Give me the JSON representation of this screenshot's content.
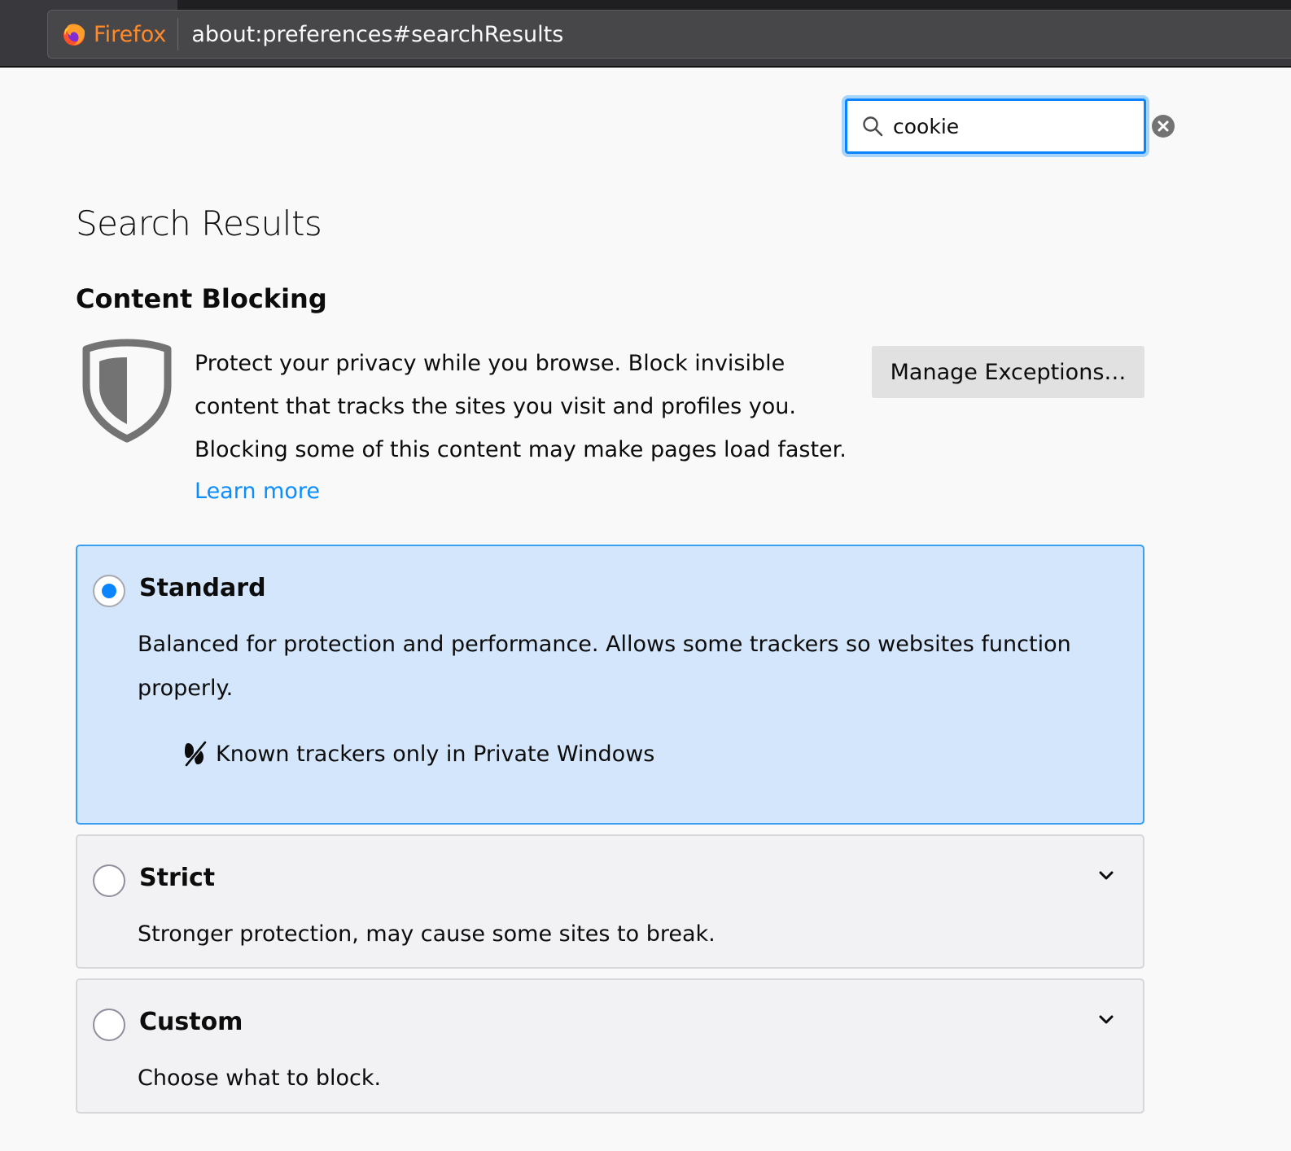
{
  "browser": {
    "name": "Firefox",
    "url": "about:preferences#searchResults"
  },
  "search": {
    "value": "cookie",
    "icon": "search-icon",
    "clear_icon": "clear-icon"
  },
  "page": {
    "title": "Search Results"
  },
  "content_blocking": {
    "heading": "Content Blocking",
    "description": "Protect your privacy while you browse. Block invisible content that tracks the sites you visit and profiles you. Blocking some of this content may make pages load faster.",
    "learn_more": "Learn more",
    "manage_button": "Manage Exceptions…",
    "options": [
      {
        "label": "Standard",
        "selected": true,
        "description": "Balanced for protection and performance. Allows some trackers so websites function properly.",
        "tracker_note": "Known trackers only in Private Windows"
      },
      {
        "label": "Strict",
        "selected": false,
        "description": "Stronger protection, may cause some sites to break."
      },
      {
        "label": "Custom",
        "selected": false,
        "description": "Choose what to block."
      }
    ]
  },
  "colors": {
    "accent": "#0a84ff",
    "link": "#0a8dff",
    "selected_card_bg": "#d4e6fb",
    "selected_card_border": "#3b9ff0",
    "firefox_orange": "#ff8a2b",
    "toolbar": "#38383d"
  }
}
